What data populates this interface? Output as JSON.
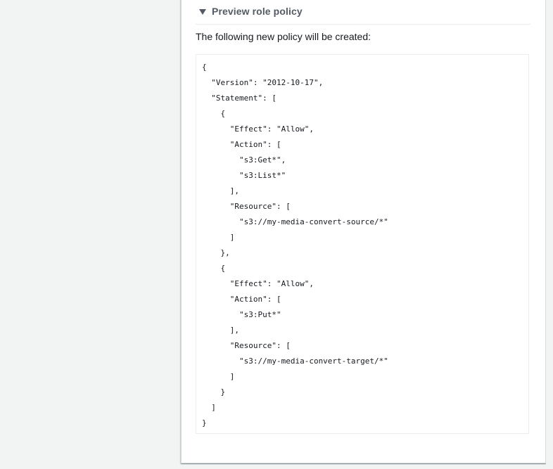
{
  "section": {
    "title": "Preview role policy",
    "description": "The following new policy will be created:"
  },
  "policy_json": "{\n  \"Version\": \"2012-10-17\",\n  \"Statement\": [\n    {\n      \"Effect\": \"Allow\",\n      \"Action\": [\n        \"s3:Get*\",\n        \"s3:List*\"\n      ],\n      \"Resource\": [\n        \"s3://my-media-convert-source/*\"\n      ]\n    },\n    {\n      \"Effect\": \"Allow\",\n      \"Action\": [\n        \"s3:Put*\"\n      ],\n      \"Resource\": [\n        \"s3://my-media-convert-target/*\"\n      ]\n    }\n  ]\n}",
  "icons": {
    "expander": "caret-down-icon"
  },
  "colors": {
    "background": "#f2f3f3",
    "panel": "#ffffff",
    "title_text": "#545b64",
    "body_text": "#16191f",
    "border": "#eaeded"
  }
}
